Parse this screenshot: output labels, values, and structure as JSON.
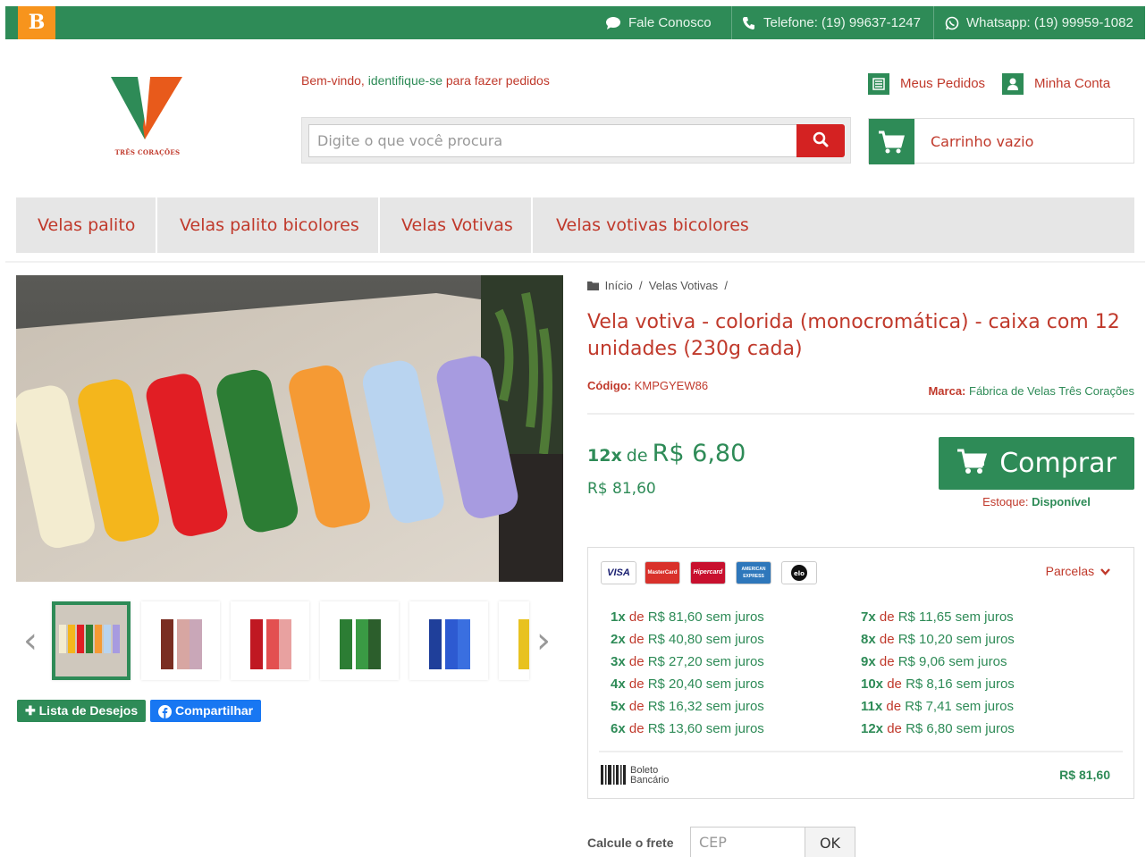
{
  "topbar": {
    "logo_letter": "B",
    "contact": "Fale Conosco",
    "phone": "Telefone: (19) 99637-1247",
    "whatsapp": "Whatsapp: (19) 99959-1082",
    "bg_color": "#2e8b57"
  },
  "header": {
    "logo_text": "TRÊS CORAÇÕES",
    "welcome_prefix": "Bem-vindo, ",
    "welcome_link": "identifique-se",
    "welcome_suffix": " para fazer pedidos",
    "search_placeholder": "Digite o que você procura",
    "my_orders": "Meus Pedidos",
    "my_account": "Minha Conta",
    "cart": "Carrinho vazio"
  },
  "nav": {
    "items": [
      "Velas palito",
      "Velas palito bicolores",
      "Velas Votivas",
      "Velas votivas bicolores"
    ]
  },
  "product": {
    "breadcrumb": [
      "Início",
      "Velas Votivas"
    ],
    "title": "Vela votiva - colorida (monocromática) - caixa com 12 unidades (230g cada)",
    "code_label": "Código:",
    "code": "KMPGYEW86",
    "brand_label": "Marca:",
    "brand": "Fábrica de Velas Três Corações",
    "inst_count": "12x",
    "inst_de": "de",
    "inst_value": "R$ 6,80",
    "total": "R$ 81,60",
    "buy": "Comprar",
    "stock_label": "Estoque:",
    "stock_value": "Disponível"
  },
  "gallery": {
    "wishlist": "Lista de Desejos",
    "share": "Compartilhar"
  },
  "payment": {
    "cards": [
      "VISA",
      "MasterCard",
      "Hipercard",
      "AMERICAN EXPRESS",
      "elo"
    ],
    "toggle": "Parcelas",
    "installments": [
      {
        "n": "1x",
        "de": "de",
        "v": "R$ 81,60 sem juros"
      },
      {
        "n": "2x",
        "de": "de",
        "v": "R$ 40,80 sem juros"
      },
      {
        "n": "3x",
        "de": "de",
        "v": "R$ 27,20 sem juros"
      },
      {
        "n": "4x",
        "de": "de",
        "v": "R$ 20,40 sem juros"
      },
      {
        "n": "5x",
        "de": "de",
        "v": "R$ 16,32 sem juros"
      },
      {
        "n": "6x",
        "de": "de",
        "v": "R$ 13,60 sem juros"
      },
      {
        "n": "7x",
        "de": "de",
        "v": "R$ 11,65 sem juros"
      },
      {
        "n": "8x",
        "de": "de",
        "v": "R$ 10,20 sem juros"
      },
      {
        "n": "9x",
        "de": "de",
        "v": "R$ 9,06 sem juros"
      },
      {
        "n": "10x",
        "de": "de",
        "v": "R$ 8,16 sem juros"
      },
      {
        "n": "11x",
        "de": "de",
        "v": "R$ 7,41 sem juros"
      },
      {
        "n": "12x",
        "de": "de",
        "v": "R$ 6,80 sem juros"
      }
    ],
    "boleto_line1": "Boleto",
    "boleto_line2": "Bancário",
    "boleto_price": "R$ 81,60"
  },
  "shipping": {
    "label": "Calcule o frete",
    "placeholder": "CEP",
    "ok": "OK"
  }
}
